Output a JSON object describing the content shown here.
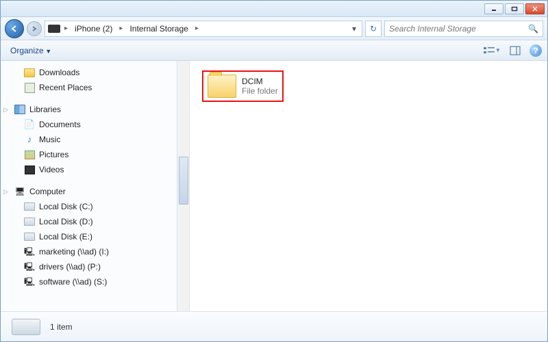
{
  "window_controls": {
    "minimize": "minimize",
    "maximize": "maximize",
    "close": "close"
  },
  "nav": {
    "breadcrumb": [
      {
        "label": "iPhone (2)"
      },
      {
        "label": "Internal Storage"
      }
    ]
  },
  "search": {
    "placeholder": "Search Internal Storage"
  },
  "toolbar": {
    "organize_label": "Organize"
  },
  "sidebar": {
    "favorites": [
      {
        "label": "Downloads",
        "icon": "folder"
      },
      {
        "label": "Recent Places",
        "icon": "recent"
      }
    ],
    "libraries_label": "Libraries",
    "libraries": [
      {
        "label": "Documents",
        "icon": "doc"
      },
      {
        "label": "Music",
        "icon": "music"
      },
      {
        "label": "Pictures",
        "icon": "pic"
      },
      {
        "label": "Videos",
        "icon": "vid"
      }
    ],
    "computer_label": "Computer",
    "computer": [
      {
        "label": "Local Disk (C:)",
        "icon": "disk"
      },
      {
        "label": "Local Disk (D:)",
        "icon": "disk"
      },
      {
        "label": "Local Disk (E:)",
        "icon": "disk"
      },
      {
        "label": "marketing (\\\\ad) (I:)",
        "icon": "net"
      },
      {
        "label": "drivers (\\\\ad) (P:)",
        "icon": "net"
      },
      {
        "label": "software (\\\\ad) (S:)",
        "icon": "net"
      }
    ]
  },
  "content": {
    "items": [
      {
        "name": "DCIM",
        "type": "File folder",
        "highlighted": true
      }
    ]
  },
  "status": {
    "count_text": "1 item"
  }
}
